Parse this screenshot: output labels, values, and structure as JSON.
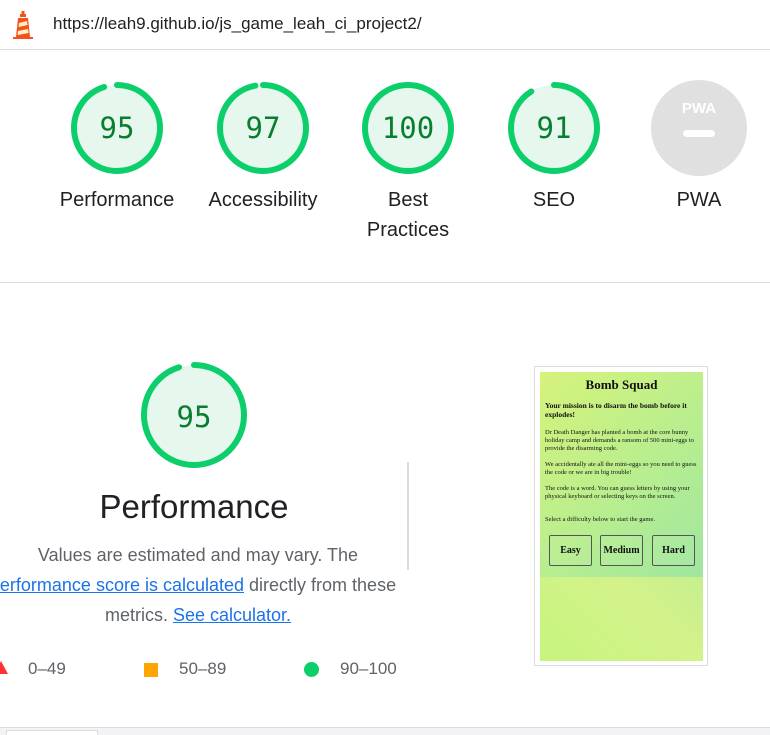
{
  "url_bar": {
    "url": "https://leah9.github.io/js_game_leah_ci_project2/",
    "icon": "lighthouse-icon"
  },
  "colors": {
    "pass": "#0cce6b",
    "pass_fill": "#e6f7ee",
    "pass_text": "#0a7e2f",
    "average": "#ffa400",
    "fail": "#ff3333",
    "na": "#e0e0e0",
    "link": "#1a73e8"
  },
  "scores": [
    {
      "label": "Performance",
      "score": 95
    },
    {
      "label": "Accessibility",
      "score": 97
    },
    {
      "label_line1": "Best",
      "label_line2": "Practices",
      "score": 100
    },
    {
      "label": "SEO",
      "score": 91
    },
    {
      "label": "PWA",
      "badge": "PWA",
      "score": null
    }
  ],
  "performance": {
    "score": 95,
    "title": "Performance",
    "desc_text1": "Values are estimated and may vary. The",
    "desc_link1": "erformance score is calculated",
    "desc_text2": "directly from these",
    "desc_text3": "metrics.",
    "desc_link2": "See calculator."
  },
  "legend": [
    {
      "range": "0–49",
      "shape": "triangle-icon"
    },
    {
      "range": "50–89",
      "shape": "square-icon"
    },
    {
      "range": "90–100",
      "shape": "circle-icon"
    }
  ],
  "screenshot": {
    "title": "Bomb Squad",
    "mission": "Your mission is to disarm the bomb before it explodes!",
    "para1": "Dr Death Danger has planted a bomb at the core bunny holiday camp and demands a ransom of 500 mini-eggs to provide the disarming code.",
    "para2": "We accidentally ate all the mini-eggs so you need to guess the code or we are in big trouble!",
    "para3": "The code is a word. You can guess letters by using your physical keyboard or selecting keys on the screen.",
    "para4": "Select a difficulty below to start the game.",
    "buttons": [
      "Easy",
      "Medium",
      "Hard"
    ]
  }
}
